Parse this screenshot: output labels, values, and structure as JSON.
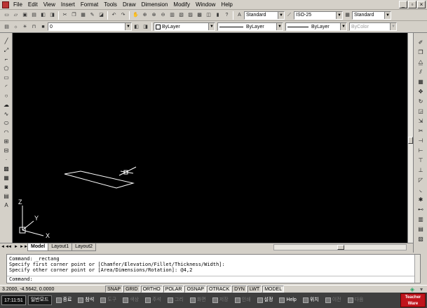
{
  "menubar": {
    "items": [
      "File",
      "Edit",
      "View",
      "Insert",
      "Format",
      "Tools",
      "Draw",
      "Dimension",
      "Modify",
      "Window",
      "Help"
    ],
    "window_buttons": [
      "_",
      "▫",
      "×"
    ]
  },
  "toolbar1": {
    "text_style": "Standard",
    "dim_style": "ISO-25",
    "table_style": "Standard"
  },
  "toolbar2": {
    "layer": "0",
    "color": "ByLayer",
    "linetype": "ByLayer",
    "lineweight": "ByLayer",
    "plot_style": "ByColor"
  },
  "ucs": {
    "x_label": "X",
    "y_label": "Y",
    "z_label": "Z"
  },
  "tabs": [
    "Model",
    "Layout1",
    "Layout2"
  ],
  "tab_nav": [
    "◄◄",
    "◄",
    "►",
    "►►"
  ],
  "command": {
    "lines": [
      "Command: _rectang",
      "Specify first corner point or [Chamfer/Elevation/Fillet/Thickness/Width]:",
      "Specify other corner point or [Area/Dimensions/Rotation]: @4,2"
    ],
    "prompt": "Command:"
  },
  "status": {
    "coords": "3.2000, -4.5642, 0.0000",
    "buttons": [
      "SNAP",
      "GRID",
      "ORTHO",
      "POLAR",
      "OSNAP",
      "OTRACK",
      "DYN",
      "LWT",
      "MODEL"
    ]
  },
  "taskbar": {
    "clock": "17:11:51",
    "mode": "일반모드",
    "items": [
      {
        "label": "종료",
        "dim": false
      },
      {
        "label": "참석",
        "dim": false
      },
      {
        "label": "도구",
        "dim": true
      },
      {
        "label": "색상",
        "dim": true
      },
      {
        "label": "주석",
        "dim": true
      },
      {
        "label": "그리",
        "dim": true
      },
      {
        "label": "화면",
        "dim": true
      },
      {
        "label": "저장",
        "dim": true
      },
      {
        "label": "인쇄",
        "dim": true
      },
      {
        "label": "설정",
        "dim": false
      },
      {
        "label": "Help",
        "dim": false
      },
      {
        "label": "위치",
        "dim": false
      },
      {
        "label": "이전",
        "dim": true
      },
      {
        "label": "다음",
        "dim": true
      }
    ],
    "badge": "Teacher Ware"
  }
}
